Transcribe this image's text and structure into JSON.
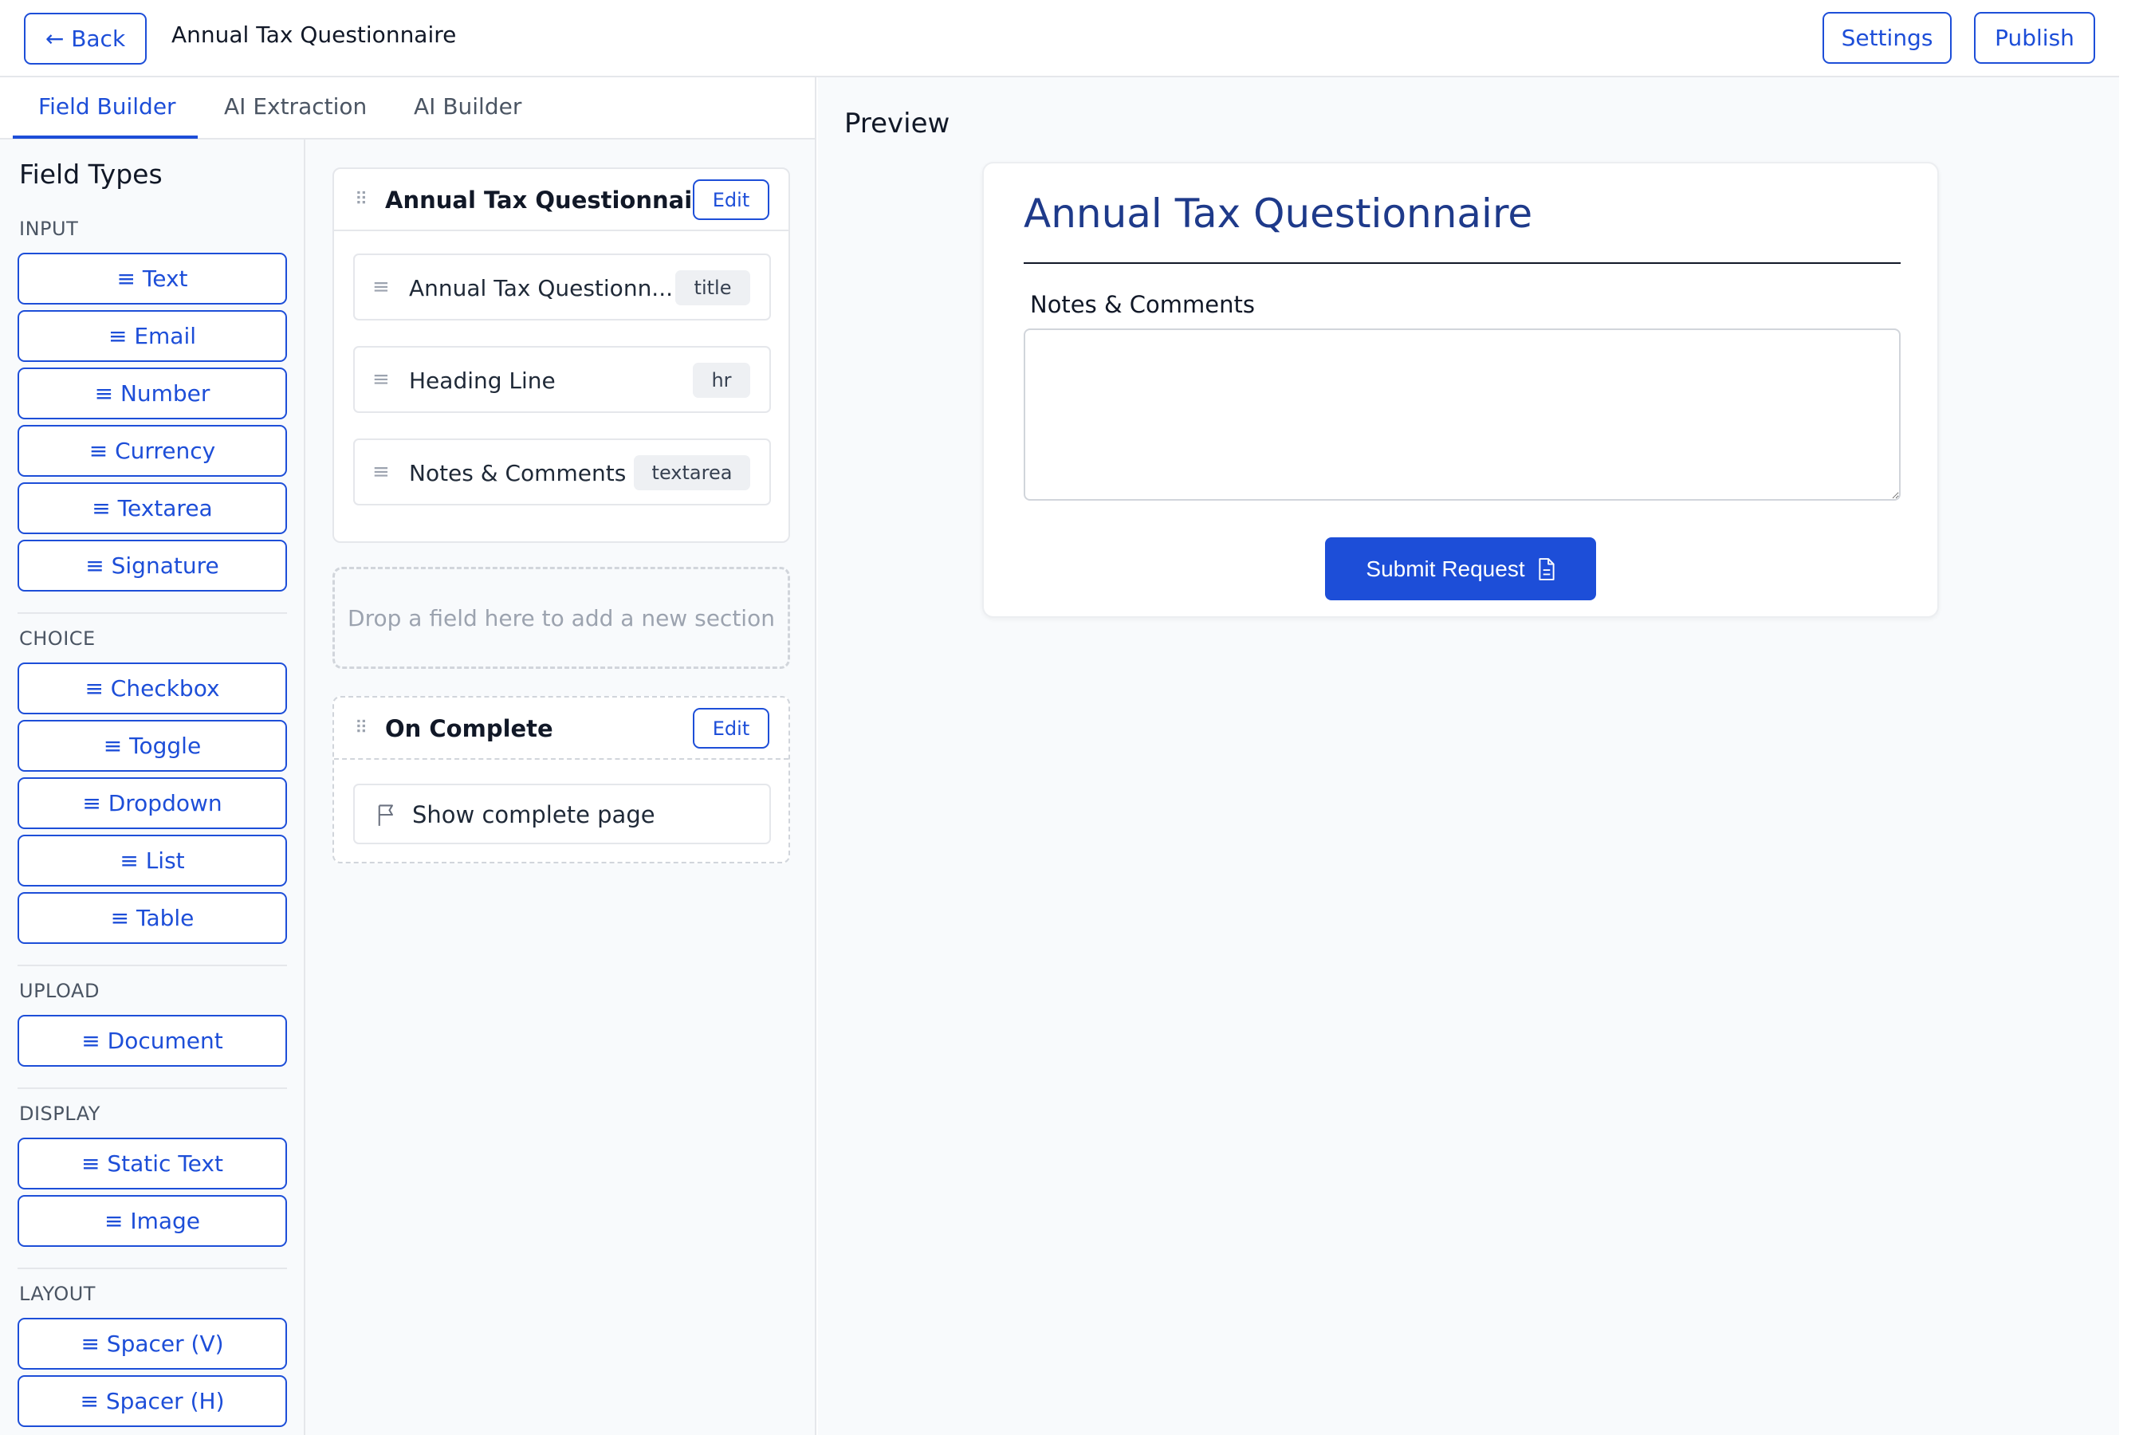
{
  "header": {
    "back_label": "← Back",
    "title": "Annual Tax Questionnaire",
    "settings_label": "Settings",
    "publish_label": "Publish"
  },
  "tabs": [
    {
      "label": "Field Builder",
      "active": true
    },
    {
      "label": "AI Extraction",
      "active": false
    },
    {
      "label": "AI Builder",
      "active": false
    }
  ],
  "field_types": {
    "title": "Field Types",
    "sections": [
      {
        "label": "INPUT",
        "items": [
          "≡ Text",
          "≡ Email",
          "≡ Number",
          "≡ Currency",
          "≡ Textarea",
          "≡ Signature"
        ]
      },
      {
        "label": "CHOICE",
        "items": [
          "≡ Checkbox",
          "≡ Toggle",
          "≡ Dropdown",
          "≡ List",
          "≡ Table"
        ]
      },
      {
        "label": "UPLOAD",
        "items": [
          "≡ Document"
        ]
      },
      {
        "label": "DISPLAY",
        "items": [
          "≡ Static Text",
          "≡ Image"
        ]
      },
      {
        "label": "LAYOUT",
        "items": [
          "≡ Spacer (V)",
          "≡ Spacer (H)"
        ]
      }
    ]
  },
  "builder": {
    "section": {
      "title": "Annual Tax Questionnaire",
      "edit_label": "Edit",
      "handle_icon": "drag-handle-icon",
      "fields": [
        {
          "label": "Annual Tax Questionn...",
          "tag": "title"
        },
        {
          "label": "Heading Line",
          "tag": "hr"
        },
        {
          "label": "Notes & Comments",
          "tag": "textarea"
        }
      ]
    },
    "dropzone_text": "Drop a field here to add a new section",
    "on_complete": {
      "title": "On Complete",
      "edit_label": "Edit",
      "action_label": "Show complete page",
      "action_icon": "flag-icon"
    }
  },
  "preview": {
    "title": "Preview",
    "form_title": "Annual Tax Questionnaire",
    "field_label": "Notes & Comments",
    "textarea_value": "",
    "submit_label": "Submit Request",
    "submit_icon": "document-icon"
  },
  "colors": {
    "accent": "#1d4ed8",
    "form_title": "#1e3a8a",
    "panel_bg": "#f8fafc",
    "border": "#e5e7eb"
  }
}
